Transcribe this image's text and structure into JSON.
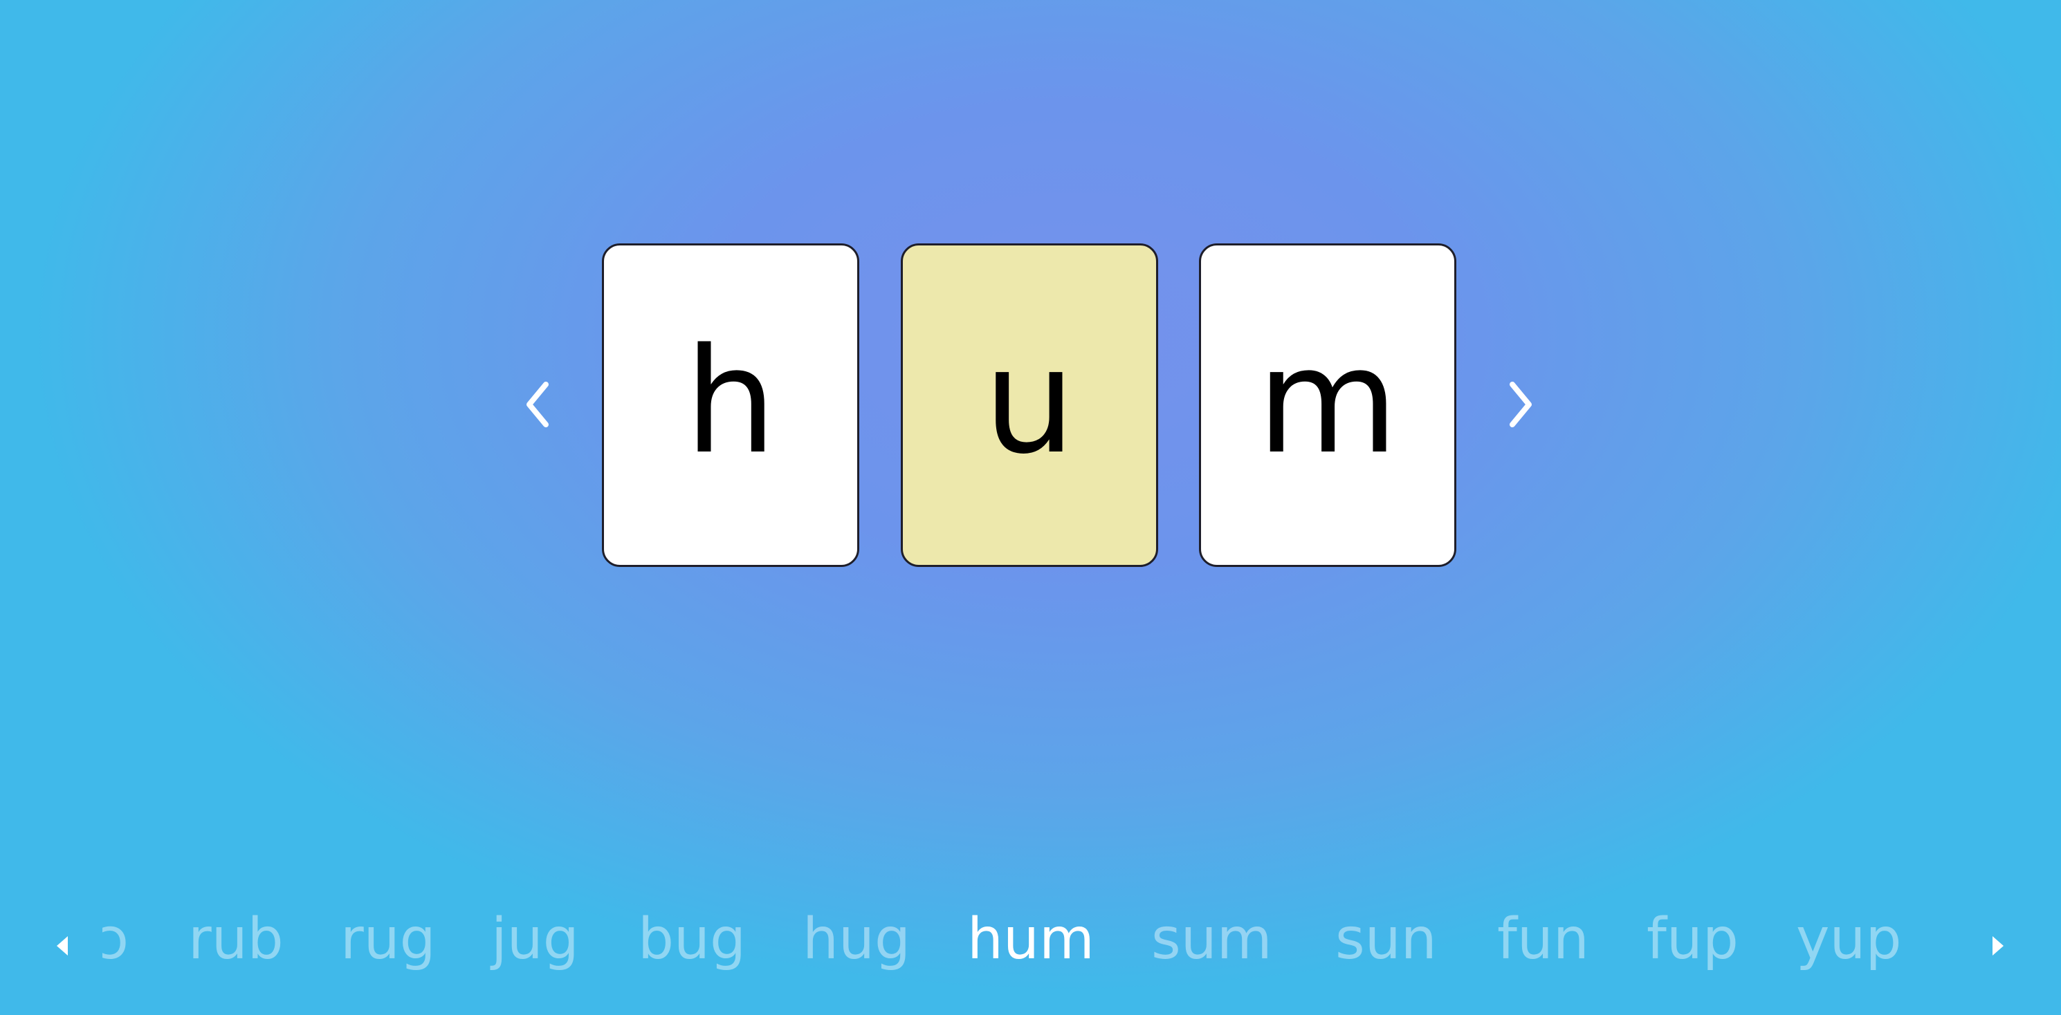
{
  "word": {
    "letters": [
      "h",
      "u",
      "m"
    ],
    "highlighted_index": 1
  },
  "word_strip": {
    "partial_word": "ɔ",
    "words": [
      "rub",
      "rug",
      "jug",
      "bug",
      "hug",
      "hum",
      "sum",
      "sun",
      "fun",
      "fup",
      "yup"
    ],
    "current": "hum"
  },
  "icons": {
    "prev_word": "chevron-left-icon",
    "next_word": "chevron-right-icon",
    "strip_prev": "triangle-left-icon",
    "strip_next": "triangle-right-icon"
  },
  "colors": {
    "card": "#ffffff",
    "card_highlight": "#ede8ac",
    "card_border": "#1e1e2a",
    "strip_word": "rgba(255,255,255,0.42)",
    "strip_word_current": "#ffffff"
  }
}
